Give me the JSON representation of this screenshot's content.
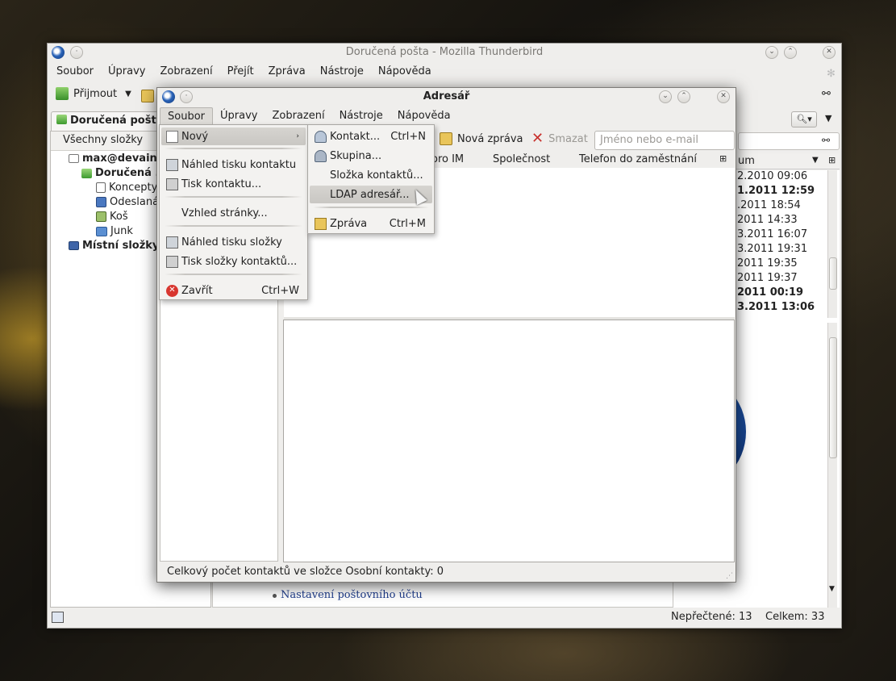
{
  "colors": {
    "accent": "#1f3d8c",
    "delete_red": "#c8322e",
    "menu_highlight": "#cfcdc9"
  },
  "main_window": {
    "title": "Doručená pošta - Mozilla Thunderbird",
    "menu": [
      "Soubor",
      "Úpravy",
      "Zobrazení",
      "Přejít",
      "Zpráva",
      "Nástroje",
      "Nápověda"
    ],
    "toolbar": {
      "receive_label": "Přijmout"
    },
    "folder_tab": "Doručená pošta",
    "folder_header": "Všechny složky",
    "folders": {
      "account": "max@devaine",
      "inbox": "Doručená ...",
      "drafts": "Koncepty",
      "sent": "Odeslaná",
      "trash": "Koš",
      "junk": "Junk",
      "local": "Místní složky"
    },
    "date_column_label": "um",
    "messages": [
      {
        "date": "2.2010 09:06",
        "bold": false
      },
      {
        "date": "1.2011 12:59",
        "bold": true
      },
      {
        "date": ".2011 18:54",
        "bold": false
      },
      {
        "date": "2011 14:33",
        "bold": false
      },
      {
        "date": "3.2011 16:07",
        "bold": false
      },
      {
        "date": "3.2011 19:31",
        "bold": false
      },
      {
        "date": "2011 19:35",
        "bold": false
      },
      {
        "date": "2011 19:37",
        "bold": false
      },
      {
        "date": "2011 00:19",
        "bold": true
      },
      {
        "date": "3.2011 13:06",
        "bold": true
      }
    ],
    "preview_link": "Nastavení poštovního účtu",
    "status": {
      "unread": "Nepřečtené: 13",
      "total": "Celkem: 33"
    }
  },
  "address_book": {
    "title": "Adresář",
    "menu": [
      "Soubor",
      "Úpravy",
      "Zobrazení",
      "Nástroje",
      "Nápověda"
    ],
    "toolbar": {
      "new_message": "Nová zpráva",
      "delete": "Smazat"
    },
    "search_placeholder": "Jméno nebo e-mail",
    "columns": [
      "oro IM",
      "Společnost",
      "Telefon do zaměstnání"
    ],
    "status": "Celkový počet kontaktů ve složce Osobní kontakty: 0"
  },
  "file_menu": {
    "items": {
      "new": "Nový",
      "print_preview_contact": "Náhled tisku kontaktu",
      "print_contact": "Tisk kontaktu...",
      "page_setup": "Vzhled stránky...",
      "print_preview_folder": "Náhled tisku složky",
      "print_folder": "Tisk složky kontaktů...",
      "close": "Zavřít"
    },
    "close_shortcut": "Ctrl+W"
  },
  "new_submenu": {
    "contact": "Kontakt...",
    "contact_shortcut": "Ctrl+N",
    "group": "Skupina...",
    "folder": "Složka kontaktů...",
    "ldap": "LDAP adresář...",
    "message": "Zpráva",
    "message_shortcut": "Ctrl+M"
  }
}
